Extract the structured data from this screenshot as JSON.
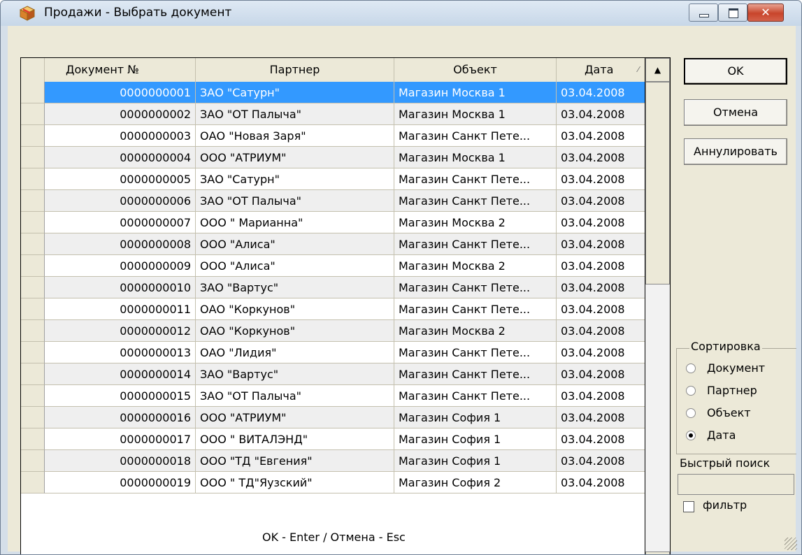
{
  "window": {
    "title": "Продажи - Выбрать документ",
    "icons": {
      "app": "box-icon",
      "minimize": "minimize-icon",
      "maximize": "maximize-icon",
      "close": "close-icon"
    },
    "close_glyph": "✕"
  },
  "table": {
    "columns": [
      "Документ №",
      "Партнер",
      "Объект",
      "Дата"
    ],
    "sort_glyph": "⁄",
    "rows": [
      [
        "0000000001",
        "ЗАО \"Сатурн\"",
        "Магазин Москва 1",
        "03.04.2008"
      ],
      [
        "0000000002",
        "ЗАО \"ОТ Палыча\"",
        "Магазин Москва 1",
        "03.04.2008"
      ],
      [
        "0000000003",
        "ОАО \"Новая Заря\"",
        "Магазин Санкт Пете...",
        "03.04.2008"
      ],
      [
        "0000000004",
        "ООО \"АТРИУМ\"",
        "Магазин Москва 1",
        "03.04.2008"
      ],
      [
        "0000000005",
        "ЗАО \"Сатурн\"",
        "Магазин Санкт Пете...",
        "03.04.2008"
      ],
      [
        "0000000006",
        "ЗАО \"ОТ Палыча\"",
        "Магазин Санкт Пете...",
        "03.04.2008"
      ],
      [
        "0000000007",
        "ООО \" Марианна\"",
        "Магазин Москва 2",
        "03.04.2008"
      ],
      [
        "0000000008",
        "ООО \"Алиса\"",
        "Магазин Санкт Пете...",
        "03.04.2008"
      ],
      [
        "0000000009",
        "ООО \"Алиса\"",
        "Магазин Москва 2",
        "03.04.2008"
      ],
      [
        "0000000010",
        "ЗАО \"Вартус\"",
        "Магазин Санкт Пете...",
        "03.04.2008"
      ],
      [
        "0000000011",
        "ОАО \"Коркунов\"",
        "Магазин Санкт Пете...",
        "03.04.2008"
      ],
      [
        "0000000012",
        "ОАО \"Коркунов\"",
        "Магазин Москва 2",
        "03.04.2008"
      ],
      [
        "0000000013",
        "ОАО \"Лидия\"",
        "Магазин Санкт Пете...",
        "03.04.2008"
      ],
      [
        "0000000014",
        "ЗАО \"Вартус\"",
        "Магазин Санкт Пете...",
        "03.04.2008"
      ],
      [
        "0000000015",
        "ЗАО \"ОТ Палыча\"",
        "Магазин Санкт Пете...",
        "03.04.2008"
      ],
      [
        "0000000016",
        "ООО \"АТРИУМ\"",
        "Магазин София 1",
        "03.04.2008"
      ],
      [
        "0000000017",
        "ООО \" ВИТАЛЭНД\"",
        "Магазин София 1",
        "03.04.2008"
      ],
      [
        "0000000018",
        "ООО \"ТД \"Евгения\"",
        "Магазин София 1",
        "03.04.2008"
      ],
      [
        "0000000019",
        "ООО \" ТД\"Яузский\"",
        "Магазин София 2",
        "03.04.2008"
      ]
    ],
    "selected_row": 0
  },
  "scrollbar": {
    "up_glyph": "▲",
    "down_glyph": "▼"
  },
  "buttons": {
    "ok": "OK",
    "cancel": "Отмена",
    "annul": "Аннулировать"
  },
  "sort": {
    "legend": "Сортировка",
    "options": [
      "Документ",
      "Партнер",
      "Объект",
      "Дата"
    ],
    "selected": 3
  },
  "quick_search": {
    "label": "Быстрый поиск",
    "value": ""
  },
  "filter": {
    "label": "фильтр",
    "checked": false
  },
  "status": "OK - Enter / Отмена - Esc"
}
